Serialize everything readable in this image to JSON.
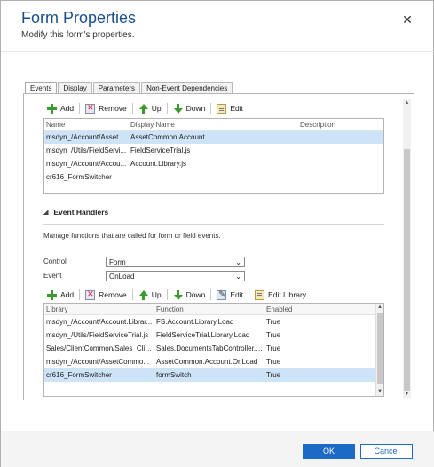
{
  "header": {
    "title": "Form Properties",
    "subtitle": "Modify this form's properties.",
    "close_glyph": "✕"
  },
  "tabs": [
    {
      "label": "Events",
      "active": true
    },
    {
      "label": "Display",
      "active": false
    },
    {
      "label": "Parameters",
      "active": false
    },
    {
      "label": "Non-Event Dependencies",
      "active": false
    }
  ],
  "library_toolbar": {
    "add": "Add",
    "remove": "Remove",
    "up": "Up",
    "down": "Down",
    "edit": "Edit"
  },
  "library_grid": {
    "columns": [
      "Name",
      "Display Name",
      "Description"
    ],
    "rows": [
      {
        "name": "msdyn_/Account/Asset...",
        "display_name": "AssetCommon.Account....",
        "description": "",
        "selected": true
      },
      {
        "name": "msdyn_/Utils/FieldServi...",
        "display_name": "FieldServiceTrial.js",
        "description": "",
        "selected": false
      },
      {
        "name": "msdyn_/Account/Accou...",
        "display_name": "Account.Library.js",
        "description": "",
        "selected": false
      },
      {
        "name": "cr616_FormSwitcher",
        "display_name": "",
        "description": "",
        "selected": false
      }
    ]
  },
  "event_handlers": {
    "section_title": "Event Handlers",
    "collapse_glyph": "◢",
    "description": "Manage functions that are called for form or field events.",
    "control_label": "Control",
    "control_value": "Form",
    "event_label": "Event",
    "event_value": "OnLoad",
    "toolbar": {
      "add": "Add",
      "remove": "Remove",
      "up": "Up",
      "down": "Down",
      "edit": "Edit",
      "edit_library": "Edit Library"
    },
    "grid": {
      "columns": [
        "Library",
        "Function",
        "Enabled"
      ],
      "rows": [
        {
          "library": "msdyn_/Account/Account.Librar...",
          "function": "FS.Account.Library.Load",
          "enabled": "True",
          "selected": false
        },
        {
          "library": "msdyn_/Utils/FieldServiceTrial.js",
          "function": "FieldServiceTrial.Library.Load",
          "enabled": "True",
          "selected": false
        },
        {
          "library": "Sales/ClientCommon/Sales_Clie...",
          "function": "Sales.DocumentsTabController.s...",
          "enabled": "True",
          "selected": false
        },
        {
          "library": "msdyn_/Account/AssetCommo...",
          "function": "AssetCommon.Account.OnLoad",
          "enabled": "True",
          "selected": false
        },
        {
          "library": "cr616_FormSwitcher",
          "function": "formSwitch",
          "enabled": "True",
          "selected": true
        }
      ]
    }
  },
  "footer": {
    "ok": "OK",
    "cancel": "Cancel"
  },
  "colors": {
    "accent": "#1b6ac6",
    "title": "#1a4f8b",
    "selected_row": "#cde3f7"
  }
}
